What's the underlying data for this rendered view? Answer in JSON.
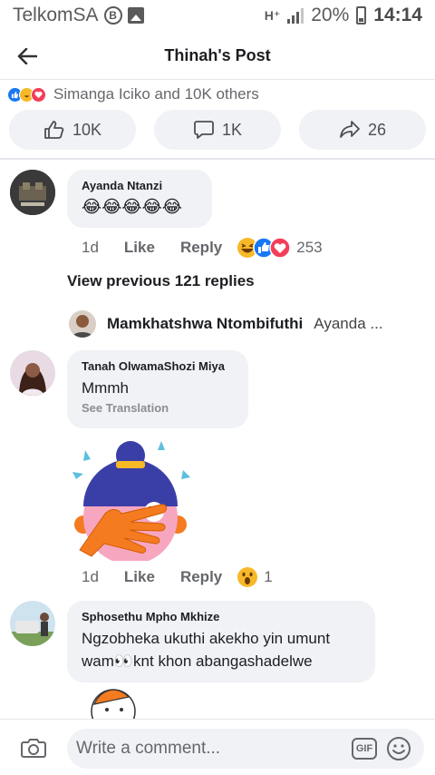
{
  "status_bar": {
    "carrier": "TelkomSA",
    "b_icon": "B",
    "network": "H⁺",
    "battery": "20%",
    "time": "14:14"
  },
  "header": {
    "title": "Thinah's Post"
  },
  "reactions": {
    "summary": "Simanga Iciko and 10K others",
    "like_count": "10K",
    "comment_count": "1K",
    "share_count": "26"
  },
  "comments": [
    {
      "author": "Ayanda Ntanzi",
      "text": "😂😂😂😂😂",
      "time": "1d",
      "like_label": "Like",
      "reply_label": "Reply",
      "reaction_count": "253"
    },
    {
      "author": "Tanah OlwamaShozi Miya",
      "text": "Mmmh",
      "see_translation": "See Translation",
      "time": "1d",
      "like_label": "Like",
      "reply_label": "Reply",
      "reaction_count": "1"
    },
    {
      "author": "Sphosethu Mpho Mkhize",
      "text_line1": "Ngzobheka ukuthi akekho yin umunt",
      "text_line2": "wam👀knt khon abangashadelwe"
    }
  ],
  "view_previous": "View previous 121 replies",
  "reply_preview": {
    "author": "Mamkhatshwa Ntombifuthi",
    "snippet": "Ayanda ..."
  },
  "composer": {
    "placeholder": "Write a comment...",
    "gif_label": "GIF"
  },
  "colors": {
    "accent": "#1877f2",
    "bubble": "#f0f2f5",
    "text_secondary": "#65676b"
  }
}
